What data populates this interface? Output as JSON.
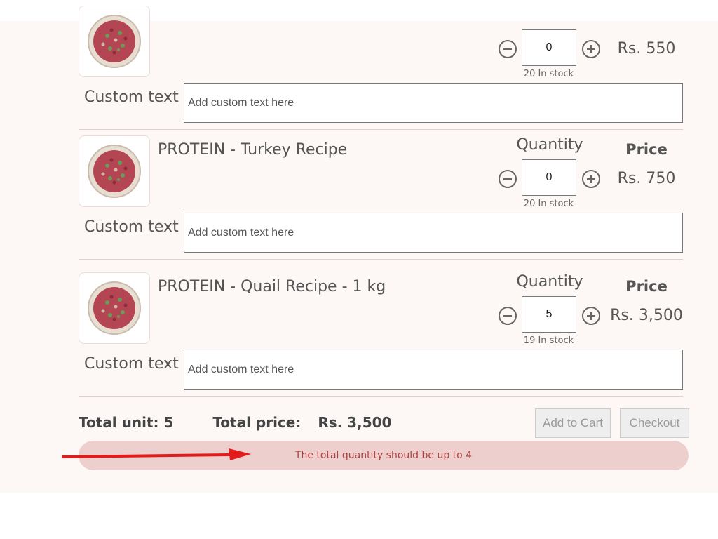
{
  "top_item": {
    "quantity_value": "0",
    "stock": "20 In stock",
    "price": "Rs. 550",
    "custom_label": "Custom text",
    "custom_placeholder": "Add custom text here"
  },
  "products": [
    {
      "name": "PROTEIN - Turkey Recipe",
      "quantity_label": "Quantity",
      "price_label": "Price",
      "quantity_value": "0",
      "stock": "20 In stock",
      "price": "Rs. 750",
      "custom_label": "Custom text",
      "custom_placeholder": "Add custom text here"
    },
    {
      "name": "PROTEIN - Quail Recipe - 1 kg",
      "quantity_label": "Quantity",
      "price_label": "Price",
      "quantity_value": "5",
      "stock": "19 In stock",
      "price": "Rs. 3,500",
      "custom_label": "Custom text",
      "custom_placeholder": "Add custom text here"
    }
  ],
  "summary": {
    "total_unit": "Total unit: 5",
    "total_price_label": "Total price:",
    "total_price_value": "Rs. 3,500",
    "add_to_cart": "Add to Cart",
    "checkout": "Checkout"
  },
  "alert": {
    "message": "The total quantity should be up to 4",
    "color": "#a94442",
    "background": "#edcfce"
  },
  "annotation": {
    "arrow_color": "#e31b1b"
  },
  "icons": {
    "product_image": "food-bowl-image",
    "decrement": "minus-circle-icon",
    "increment": "plus-circle-icon"
  }
}
